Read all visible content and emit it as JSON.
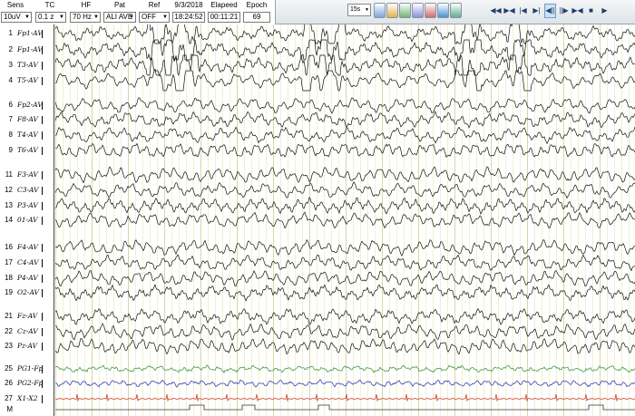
{
  "settings": {
    "sens": {
      "label": "Sens",
      "value": "10uV"
    },
    "tc": {
      "label": "TC",
      "value": "0.1 z"
    },
    "hf": {
      "label": "HF",
      "value": "70 Hz"
    },
    "pat": {
      "label": "Pat",
      "value": "ALI AVE"
    },
    "ref": {
      "label": "Ref",
      "value": "OFF"
    },
    "date": {
      "label": "9/3/2018",
      "value": "18:24:52"
    },
    "elapsed": {
      "label": "Elapeed",
      "value": "00:11:21"
    },
    "epoch": {
      "label": "Epoch",
      "value": "69"
    }
  },
  "toolbar": {
    "page_select": "15s",
    "tools": [
      "montage-tool-icon",
      "paint-tool-icon",
      "chart-tool-icon",
      "pen-tool-icon",
      "marker-tool-icon",
      "print-tool-icon",
      "export-tool-icon"
    ],
    "nav": [
      {
        "name": "skip-back-icon",
        "glyph": "◀◀"
      },
      {
        "name": "step-back-icon",
        "glyph": "▶◀"
      },
      {
        "name": "first-page-icon",
        "glyph": "|◀"
      },
      {
        "name": "prev-page-icon",
        "glyph": "▶|"
      },
      {
        "name": "reverse-play-icon",
        "glyph": "◀||"
      },
      {
        "name": "forward-play-icon",
        "glyph": "||▶"
      },
      {
        "name": "step-forward-icon",
        "glyph": "▶◀"
      },
      {
        "name": "stop-icon",
        "glyph": "■"
      },
      {
        "name": "play-icon",
        "glyph": "▶"
      }
    ]
  },
  "channels": [
    {
      "num": "1",
      "name": "Fp1-AV"
    },
    {
      "num": "2",
      "name": "Fp1-AV"
    },
    {
      "num": "3",
      "name": "T3-AV"
    },
    {
      "num": "4",
      "name": "T5-AV"
    },
    {
      "num": "6",
      "name": "Fp2-AV"
    },
    {
      "num": "7",
      "name": "F8-AV"
    },
    {
      "num": "8",
      "name": "T4-AV"
    },
    {
      "num": "9",
      "name": "T6-AV"
    },
    {
      "num": "11",
      "name": "F3-AV"
    },
    {
      "num": "12",
      "name": "C3-AV"
    },
    {
      "num": "13",
      "name": "P3-AV"
    },
    {
      "num": "14",
      "name": "01-AV"
    },
    {
      "num": "16",
      "name": "F4-AV"
    },
    {
      "num": "17",
      "name": "C4-AV"
    },
    {
      "num": "18",
      "name": "P4-AV"
    },
    {
      "num": "19",
      "name": "O2-AV"
    },
    {
      "num": "21",
      "name": "Fz-AV"
    },
    {
      "num": "22",
      "name": "Cz-AV"
    },
    {
      "num": "23",
      "name": "Pz-AV"
    },
    {
      "num": "25",
      "name": "PG1-Fp"
    },
    {
      "num": "26",
      "name": "PG2-Fp"
    },
    {
      "num": "27",
      "name": "X1-X2"
    },
    {
      "num": "M",
      "name": ""
    }
  ],
  "colors": {
    "eeg": "#111111",
    "pg1": "#3e9a4a",
    "pg2": "#3d3fae",
    "ecg": "#d23b2a",
    "grid_major": "#d9d9a0",
    "grid_minor": "#f1f1cf"
  }
}
